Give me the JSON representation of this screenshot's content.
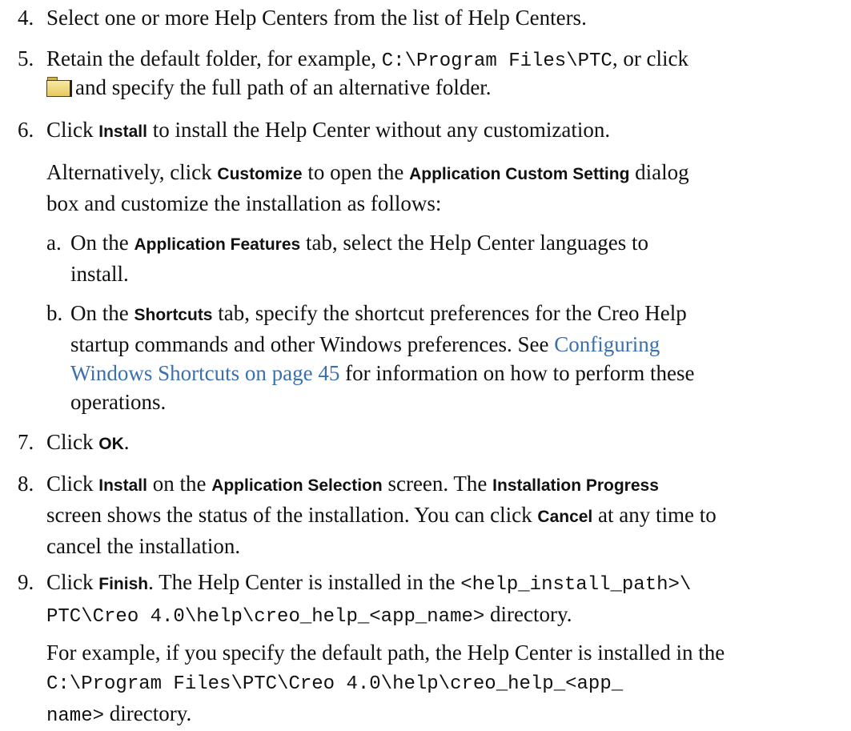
{
  "steps": {
    "s4": {
      "num": "4.",
      "text": "Select one or more Help Centers from the list of Help Centers."
    },
    "s5": {
      "num": "5.",
      "t1": "Retain the default folder, for example, ",
      "path": "C:\\Program Files\\PTC",
      "t2": ", or click",
      "t3": "and specify the full path of an alternative folder."
    },
    "s6": {
      "num": "6.",
      "t1": "Click ",
      "b1": "Install",
      "t2": " to install the Help Center without any customization.",
      "p_t1": "Alternatively, click ",
      "p_b1": "Customize",
      "p_t2": " to open the ",
      "p_b2": "Application Custom Setting",
      "p_t3": " dialog",
      "p_t4": "box and customize the installation as follows:",
      "a": {
        "letter": "a.",
        "t1": "On the ",
        "b1": "Application Features",
        "t2": " tab, select the Help Center languages to",
        "t3": "install."
      },
      "b": {
        "letter": "b.",
        "t1": "On the ",
        "b1": "Shortcuts",
        "t2": " tab, specify the shortcut preferences for the Creo Help",
        "t3": "startup commands and other Windows preferences. See ",
        "link1": "Configuring",
        "link2": "Windows Shortcuts on page 45",
        "t4": " for information on how to perform these",
        "t5": "operations."
      }
    },
    "s7": {
      "num": "7.",
      "t1": "Click ",
      "b1": "OK",
      "t2": "."
    },
    "s8": {
      "num": "8.",
      "t1": "Click ",
      "b1": "Install",
      "t2": " on the ",
      "b2": "Application Selection",
      "t3": " screen. The ",
      "b3": "Installation Progress",
      "t4": "screen shows the status of the installation. You can click ",
      "b4": "Cancel",
      "t5": " at any time to",
      "t6": "cancel the installation."
    },
    "s9": {
      "num": "9.",
      "t1": "Click ",
      "b1": "Finish",
      "t2": ". The Help Center is installed in the ",
      "m1": "<help_install_path>\\",
      "m2": "PTC\\Creo 4.0\\help\\creo_help_<app_name>",
      "t3": " directory.",
      "p_t1": "For example, if you specify the default path, the Help Center is installed in the",
      "p_m1": "C:\\Program Files\\PTC\\Creo 4.0\\help\\creo_help_<app_",
      "p_m2": "name>",
      "p_t2": " directory."
    }
  },
  "icons": {
    "folder": "folder-icon"
  },
  "colors": {
    "link": "#3a6fb0",
    "text": "#111111"
  }
}
